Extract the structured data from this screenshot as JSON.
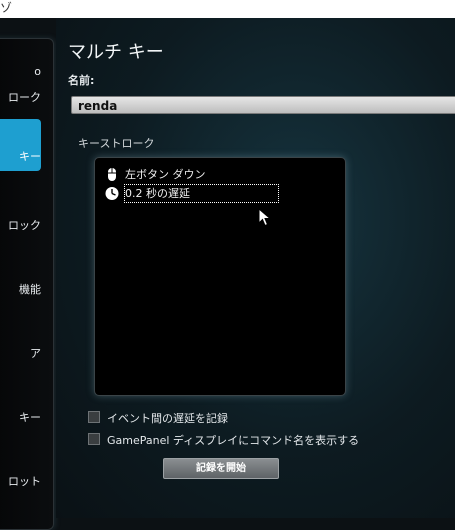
{
  "window": {
    "corner_glyph": "ゾ"
  },
  "sidebar": {
    "items": [
      {
        "label": "o"
      },
      {
        "label": "ローク"
      },
      {
        "label": "キー"
      },
      {
        "label": "ロック"
      },
      {
        "label": "機能"
      },
      {
        "label": "ア"
      },
      {
        "label": "キー"
      },
      {
        "label": "ロット"
      }
    ]
  },
  "main": {
    "title": "マルチ キー",
    "name_label": "名前:",
    "name_value": "renda",
    "keystroke_label": "キーストローク",
    "keystrokes": [
      {
        "icon": "mouse-icon",
        "text": "左ボタン ダウン"
      },
      {
        "icon": "clock-icon",
        "text": "0.2 秒の遅延"
      }
    ],
    "options": [
      {
        "label": "イベント間の遅延を記録",
        "checked": false
      },
      {
        "label": "GamePanel ディスプレイにコマンド名を表示する",
        "checked": false
      }
    ],
    "record_button": "記録を開始"
  },
  "colors": {
    "accent": "#1e9fd0",
    "background": "#0c1114"
  }
}
